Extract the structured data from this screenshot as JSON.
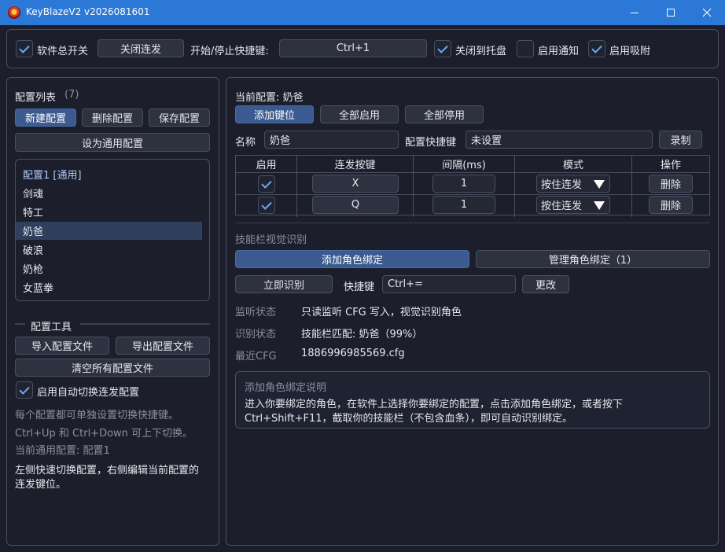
{
  "window": {
    "title": "KeyBlazeV2 v2026081601"
  },
  "top_bar": {
    "master_switch_label": "软件总开关",
    "master_switch_checked": true,
    "toggle_rapid_button": "关闭连发",
    "hotkey_label": "开始/停止快捷键:",
    "hotkey_value": "Ctrl+1",
    "close_to_tray_label": "关闭到托盘",
    "close_to_tray_checked": true,
    "notify_label": "启用通知",
    "notify_checked": false,
    "snap_label": "启用吸附",
    "snap_checked": true
  },
  "left": {
    "list_title": "配置列表",
    "list_count": "(7)",
    "new_button": "新建配置",
    "delete_button": "删除配置",
    "save_button": "保存配置",
    "set_default_button": "设为通用配置",
    "profiles": [
      "配置1 [通用]",
      "剑魂",
      "特工",
      "奶爸",
      "破浪",
      "奶枪",
      "女蓝拳"
    ],
    "selected_index": 3,
    "tools_title": "配置工具",
    "import_button": "导入配置文件",
    "export_button": "导出配置文件",
    "clear_button": "清空所有配置文件",
    "auto_switch_label": "启用自动切换连发配置",
    "auto_switch_checked": true,
    "hint1": "每个配置都可单独设置切换快捷键。",
    "hint2": "Ctrl+Up 和 Ctrl+Down 可上下切换。",
    "current_default": "当前通用配置: 配置1",
    "footer_line1": "左侧快速切换配置，右侧编辑当前配置的",
    "footer_line2": "连发键位。"
  },
  "right": {
    "current_profile": "当前配置: 奶爸",
    "add_key_button": "添加键位",
    "enable_all_button": "全部启用",
    "disable_all_button": "全部停用",
    "name_label": "名称",
    "name_value": "奶爸",
    "profile_hotkey_label": "配置快捷键",
    "profile_hotkey_value": "未设置",
    "record_button": "录制",
    "table": {
      "headers": [
        "启用",
        "连发按键",
        "间隔(ms)",
        "模式",
        "操作"
      ],
      "rows": [
        {
          "enabled": true,
          "key": "X",
          "interval": "1",
          "mode": "按住连发",
          "action": "删除"
        },
        {
          "enabled": true,
          "key": "Q",
          "interval": "1",
          "mode": "按住连发",
          "action": "删除"
        }
      ]
    },
    "vision_title": "技能栏视觉识别",
    "add_binding_button": "添加角色绑定",
    "manage_binding_button": "管理角色绑定（1）",
    "detect_now_button": "立即识别",
    "vision_hotkey_label": "快捷键",
    "vision_hotkey_value": "Ctrl+=",
    "change_button": "更改",
    "monitor_label": "监听状态",
    "monitor_value": "只读监听 CFG 写入，视觉识别角色",
    "detect_label": "识别状态",
    "detect_value": "技能栏匹配: 奶爸（99%）",
    "cfg_label": "最近CFG",
    "cfg_value": "1886996985569.cfg",
    "help_title": "添加角色绑定说明",
    "help_line1": "进入你要绑定的角色，在软件上选择你要绑定的配置，点击添加角色绑定，或者按下",
    "help_line2": "Ctrl+Shift+F11，截取你的技能栏（不包含血条），即可自动识别绑定。"
  }
}
